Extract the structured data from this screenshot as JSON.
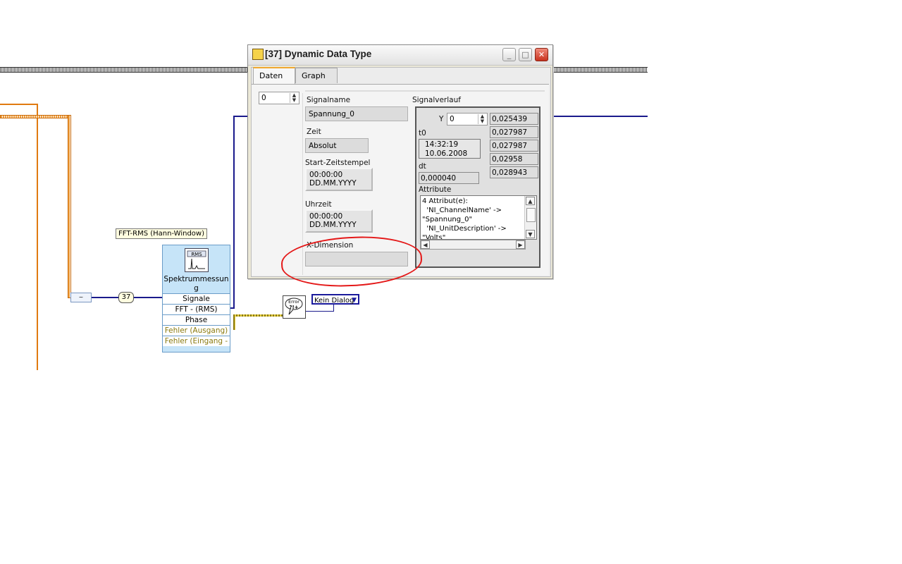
{
  "diagram": {
    "label_fft_rms": "FFT-RMS (Hann-Window)",
    "constant_value": "37",
    "express_vi": {
      "title": "Spektrummessun g",
      "terminals": [
        "Signale",
        "FFT - (RMS)",
        "Phase",
        "Fehler (Ausgang)",
        "Fehler (Eingang -"
      ]
    },
    "error_ring_value": "Kein Dialog",
    "error_icon_text": "Error ?!+",
    "sub_icon_text": "~"
  },
  "window": {
    "title": "[37] Dynamic Data Type",
    "tabs": [
      {
        "label": "Daten",
        "active": true
      },
      {
        "label": "Graph",
        "active": false
      }
    ],
    "index_value": "0",
    "signalname_label": "Signalname",
    "signalname_value": "Spannung_0",
    "zeit_label": "Zeit",
    "zeit_value": "Absolut",
    "start_label": "Start-Zeitstempel",
    "start_time": "00:00:00",
    "start_date": "DD.MM.YYYY",
    "uhrzeit_label": "Uhrzeit",
    "uhrzeit_time": "00:00:00",
    "uhrzeit_date": "DD.MM.YYYY",
    "xdim_label": "X-Dimension",
    "xdim_value": "",
    "signalverlauf_label": "Signalverlauf",
    "y_label": "Y",
    "y_index": "0",
    "y_values": [
      "0,025439",
      "0,027987",
      "0,027987",
      "0,02958",
      "0,028943"
    ],
    "t0_label": "t0",
    "t0_time": "14:32:19",
    "t0_date": "10.06.2008",
    "dt_label": "dt",
    "dt_value": "0,000040",
    "attribute_label": "Attribute",
    "attribute_lines": [
      "4 Attribut(e):",
      "  'NI_ChannelName' ->",
      "\"Spannung_0\"",
      "  'NI_UnitDescription' ->",
      "\"Volts\""
    ]
  },
  "colors": {
    "dynamic_wire": "#1a1a8c",
    "orange_wire": "#e07a10",
    "error_wire": "#b8a020",
    "annotation": "#e41818"
  }
}
